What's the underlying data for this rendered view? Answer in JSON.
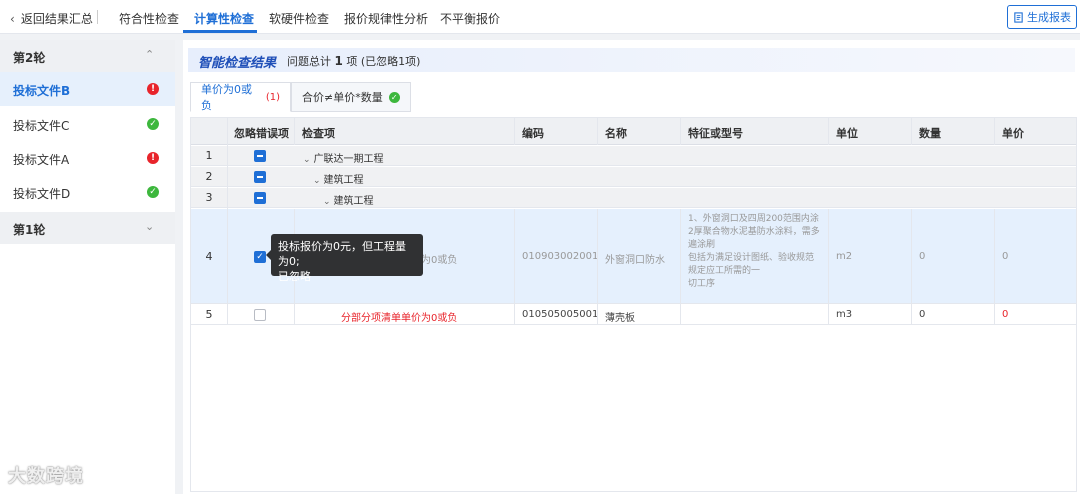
{
  "nav": {
    "back_label": "返回结果汇总",
    "tabs": [
      "符合性检查",
      "计算性检查",
      "软硬件检查",
      "报价规律性分析",
      "不平衡报价"
    ],
    "active_tab": "计算性检查",
    "report_button": "生成报表"
  },
  "sidebar": {
    "rounds": [
      {
        "label": "第2轮",
        "expanded": true
      },
      {
        "label": "第1轮",
        "expanded": false
      }
    ],
    "files": [
      {
        "label": "投标文件B",
        "status": "error",
        "badge": "!"
      },
      {
        "label": "投标文件C",
        "status": "ok",
        "badge": "✓"
      },
      {
        "label": "投标文件A",
        "status": "error",
        "badge": "!"
      },
      {
        "label": "投标文件D",
        "status": "ok",
        "badge": "✓"
      }
    ],
    "selected_file": "投标文件B"
  },
  "watermark": "大数跨境",
  "result": {
    "title": "智能检查结果",
    "summary_prefix": "问题总计",
    "total": "1",
    "summary_suffix": "项",
    "ignored": "(已忽略1项)"
  },
  "subtabs": [
    {
      "label": "单价为0或负",
      "count": "(1)",
      "active": true
    },
    {
      "label": "合价≠单价*数量",
      "ok": true,
      "active": false
    }
  ],
  "table": {
    "headers": [
      "忽略错误项",
      "检查项",
      "编码",
      "名称",
      "特征或型号",
      "单位",
      "数量",
      "单价"
    ],
    "rows": [
      {
        "num": "1",
        "check": "indeterminate",
        "tree": "广联达一期工程"
      },
      {
        "num": "2",
        "check": "indeterminate",
        "tree": "建筑工程"
      },
      {
        "num": "3",
        "check": "indeterminate",
        "tree": "建筑工程"
      },
      {
        "num": "4",
        "check": "checked",
        "item": "分部分项清单单价为0或负",
        "code": "010903002001",
        "name": "外窗洞口防水",
        "spec": [
          "1、外窗洞口及四周200范围内涂",
          "2厚聚合物水泥基防水涂料，需多",
          "遍涂刷",
          "包括为满足设计图纸、验收规范",
          "规定应工所需的一",
          "切工序"
        ],
        "unit": "m2",
        "qty": "0",
        "price": "0"
      },
      {
        "num": "5",
        "check": "empty",
        "item": "分部分项清单单价为0或负",
        "code": "010505005001",
        "name": "薄壳板",
        "spec": [],
        "unit": "m3",
        "qty": "0",
        "price": "0"
      }
    ]
  },
  "tooltip": {
    "line1": "投标报价为0元，但工程量为0;",
    "line2": "已忽略"
  }
}
